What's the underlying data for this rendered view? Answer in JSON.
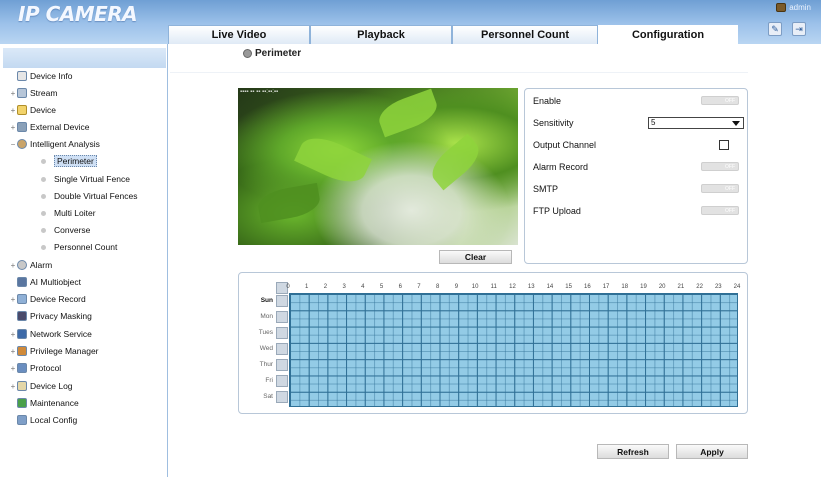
{
  "header": {
    "logo": "IP CAMERA",
    "user": "admin",
    "tabs": [
      {
        "label": "Live Video",
        "active": false
      },
      {
        "label": "Playback",
        "active": false
      },
      {
        "label": "Personnel Count",
        "active": false
      },
      {
        "label": "Configuration",
        "active": true
      }
    ]
  },
  "sidebar": {
    "items": [
      {
        "label": "Device Info",
        "icon": "document-icon"
      },
      {
        "label": "Stream",
        "icon": "stream-icon"
      },
      {
        "label": "Device",
        "icon": "folder-icon"
      },
      {
        "label": "External Device",
        "icon": "plug-icon"
      },
      {
        "label": "Intelligent Analysis",
        "icon": "gear-icon"
      },
      {
        "label": "Perimeter",
        "icon": "dot",
        "selected": true
      },
      {
        "label": "Single Virtual Fence",
        "icon": "dot"
      },
      {
        "label": "Double Virtual Fences",
        "icon": "dot"
      },
      {
        "label": "Multi Loiter",
        "icon": "dot"
      },
      {
        "label": "Converse",
        "icon": "dot"
      },
      {
        "label": "Personnel Count",
        "icon": "dot"
      },
      {
        "label": "Alarm",
        "icon": "alarm-icon"
      },
      {
        "label": "AI Multiobject",
        "icon": "ai-icon"
      },
      {
        "label": "Device Record",
        "icon": "record-icon"
      },
      {
        "label": "Privacy Masking",
        "icon": "mask-icon"
      },
      {
        "label": "Network Service",
        "icon": "network-icon"
      },
      {
        "label": "Privilege Manager",
        "icon": "users-icon"
      },
      {
        "label": "Protocol",
        "icon": "protocol-icon"
      },
      {
        "label": "Device Log",
        "icon": "log-icon"
      },
      {
        "label": "Maintenance",
        "icon": "wrench-icon"
      },
      {
        "label": "Local Config",
        "icon": "monitor-icon"
      }
    ]
  },
  "content": {
    "title": "Perimeter",
    "clear_label": "Clear",
    "settings": {
      "enable": "Enable",
      "sensitivity": "Sensitivity",
      "sensitivity_value": "5",
      "output_channel": "Output Channel",
      "alarm_record": "Alarm Record",
      "smtp": "SMTP",
      "ftp_upload": "FTP Upload",
      "toggle_off": "OFF"
    },
    "schedule": {
      "days": [
        "Sun",
        "Mon",
        "Tues",
        "Wed",
        "Thur",
        "Fri",
        "Sat"
      ],
      "hours": [
        "0",
        "1",
        "2",
        "3",
        "4",
        "5",
        "6",
        "7",
        "8",
        "9",
        "10",
        "11",
        "12",
        "13",
        "14",
        "15",
        "16",
        "17",
        "18",
        "19",
        "20",
        "21",
        "22",
        "23",
        "24"
      ]
    },
    "refresh_label": "Refresh",
    "apply_label": "Apply"
  },
  "colors": {
    "header": "#8fb7e2",
    "grid_fill": "#93cbe6",
    "grid_line": "#2f6f95"
  }
}
